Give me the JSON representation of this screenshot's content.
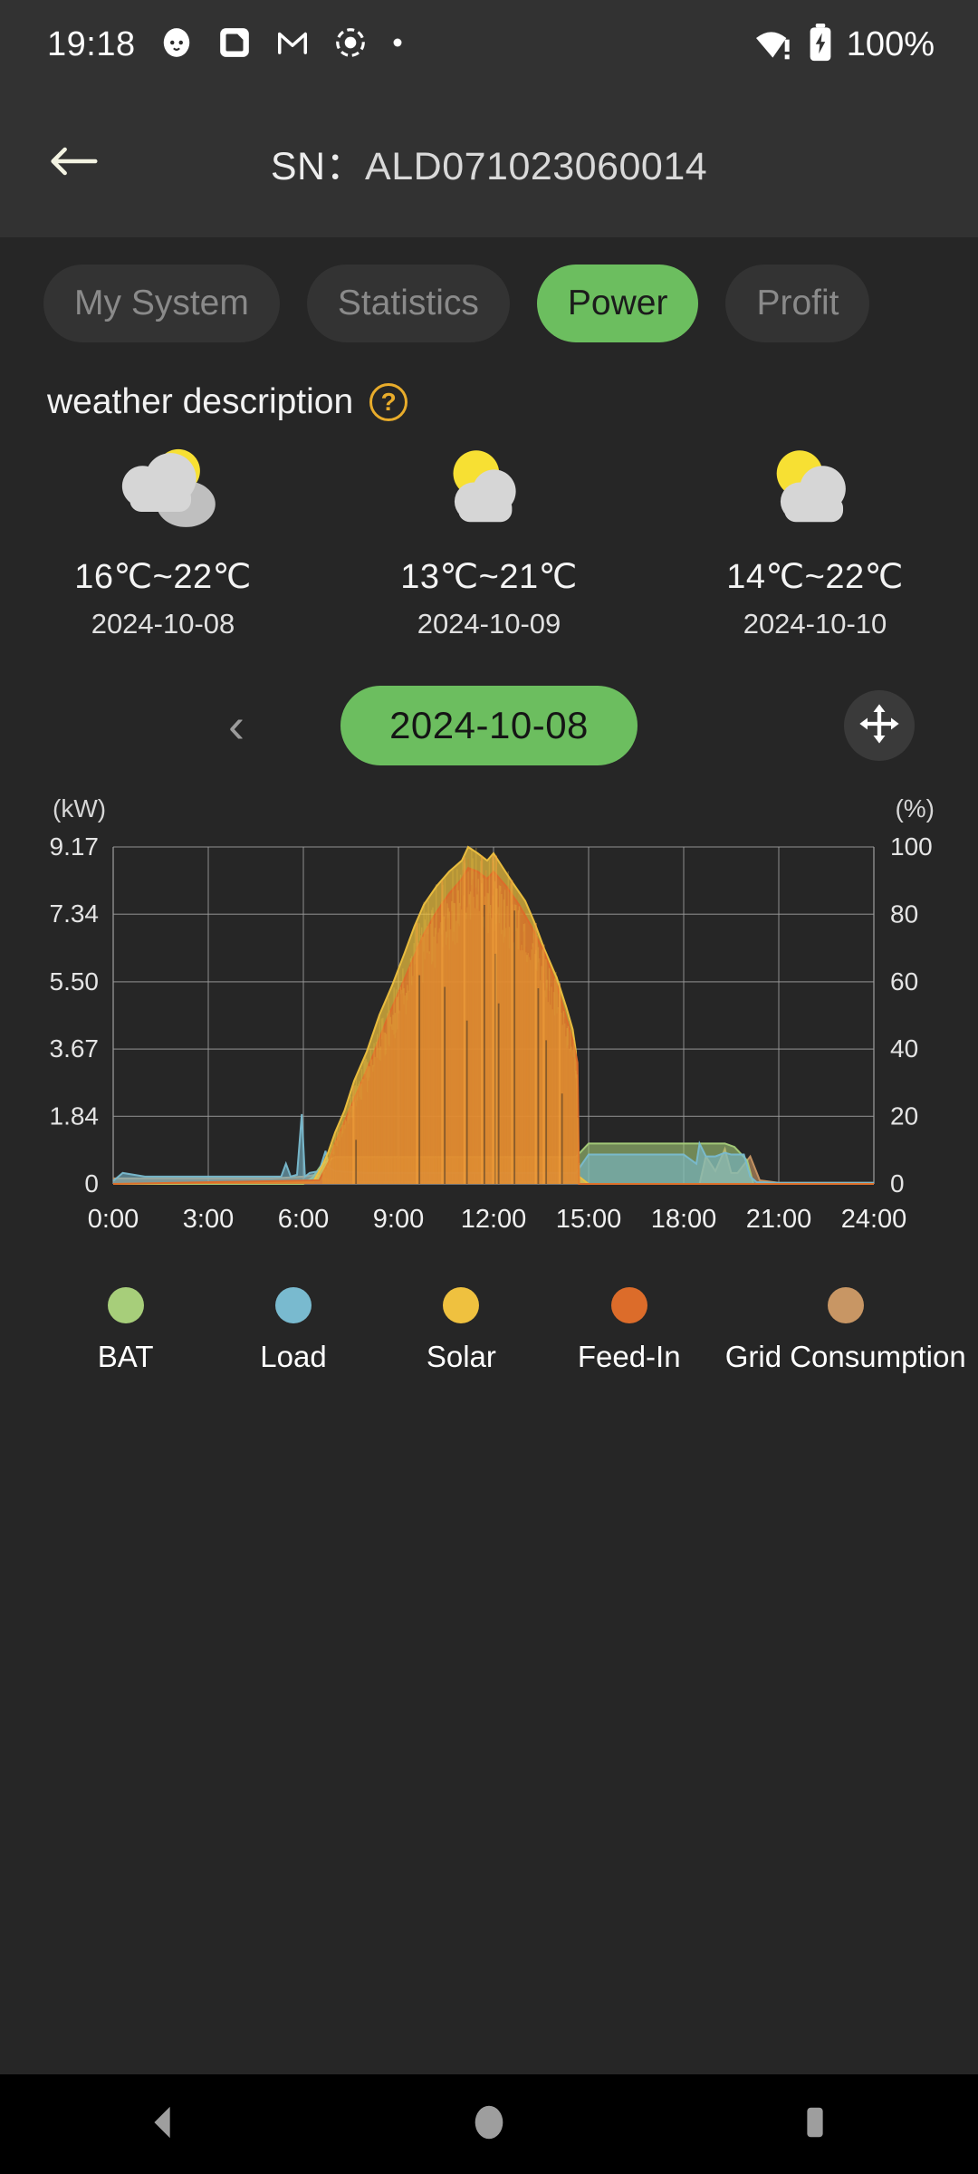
{
  "status_bar": {
    "time": "19:18",
    "battery_percent": "100%",
    "icons": [
      "cat-face-icon",
      "note-app-icon",
      "gmail-icon",
      "camera-record-icon",
      "dot-icon"
    ],
    "wifi_icon": "wifi-warning-icon",
    "battery_icon": "battery-charging-icon"
  },
  "app_bar": {
    "back_icon": "back-arrow-icon",
    "sn_key": "SN：",
    "sn_value": "ALD071023060014"
  },
  "tabs": [
    {
      "label": "My System",
      "active": false
    },
    {
      "label": "Statistics",
      "active": false
    },
    {
      "label": "Power",
      "active": true
    },
    {
      "label": "Profit",
      "active": false
    }
  ],
  "weather": {
    "title": "weather description",
    "help_icon": "question-mark-icon",
    "forecast": [
      {
        "icon": "partly-cloudy-icon",
        "temp": "16℃~22℃",
        "date": "2024-10-08"
      },
      {
        "icon": "partly-cloudy-icon",
        "temp": "13℃~21℃",
        "date": "2024-10-09"
      },
      {
        "icon": "partly-cloudy-icon",
        "temp": "14℃~22℃",
        "date": "2024-10-10"
      }
    ]
  },
  "date_selector": {
    "prev_icon": "chevron-left-icon",
    "current_date": "2024-10-08",
    "fullscreen_icon": "move-expand-icon"
  },
  "colors": {
    "accent_green": "#6cbe5f",
    "bat": "#a7ce7a",
    "load": "#79bacf",
    "solar": "#efc13f",
    "feed_in": "#dc6c2a",
    "grid": "#c89664",
    "background": "#262626",
    "grid_line": "#9a9a9a"
  },
  "chart_data": {
    "type": "area",
    "title": "",
    "xlabel": "",
    "ylabel": "(kW)",
    "y2label": "(%)",
    "grid": true,
    "legend_position": "bottom",
    "ylim": [
      0,
      9.17
    ],
    "y2lim": [
      0,
      100
    ],
    "ytick_labels": [
      "0",
      "1.84",
      "3.67",
      "5.50",
      "7.34",
      "9.17"
    ],
    "ytick_values": [
      0,
      1.84,
      3.67,
      5.5,
      7.34,
      9.17
    ],
    "y2tick_labels": [
      "0",
      "20",
      "40",
      "60",
      "80",
      "100"
    ],
    "y2tick_values": [
      0,
      20,
      40,
      60,
      80,
      100
    ],
    "xtick_labels": [
      "0:00",
      "3:00",
      "6:00",
      "9:00",
      "12:00",
      "15:00",
      "18:00",
      "21:00",
      "24:00"
    ],
    "xlim": [
      0,
      24
    ],
    "series": [
      {
        "name": "BAT",
        "color": "#a7ce7a",
        "axis": "right",
        "x": [
          0,
          5.0,
          5.5,
          6.0,
          6.3,
          6.6,
          7.0,
          8.0,
          9.0,
          10.0,
          11.0,
          12.0,
          13.0,
          14.0,
          14.6,
          15.0,
          16.0,
          17.0,
          18.0,
          18.6,
          19.0,
          19.3,
          19.6,
          20.0,
          20.2,
          21.0,
          24.0
        ],
        "values": [
          0,
          0,
          0,
          0,
          2,
          6,
          8,
          8,
          8,
          8,
          8,
          8,
          8,
          8,
          8,
          12,
          12,
          12,
          12,
          12,
          12,
          12,
          11,
          7,
          0,
          0,
          0
        ]
      },
      {
        "name": "Load",
        "color": "#79bacf",
        "axis": "left",
        "x": [
          0,
          0.3,
          1.0,
          2.0,
          3.0,
          4.0,
          5.0,
          5.3,
          5.45,
          5.6,
          5.8,
          5.95,
          6.05,
          6.2,
          6.5,
          6.7,
          6.8,
          7.0,
          8.0,
          9.0,
          11.0,
          12.0,
          13.0,
          14.0,
          14.6,
          15.0,
          16.0,
          17.0,
          18.0,
          18.4,
          18.5,
          18.7,
          19.0,
          19.3,
          19.5,
          19.6,
          19.9,
          20.1,
          20.3,
          21.0,
          24.0
        ],
        "values": [
          0.08,
          0.3,
          0.2,
          0.2,
          0.2,
          0.2,
          0.2,
          0.2,
          0.55,
          0.2,
          0.25,
          1.9,
          0.2,
          0.3,
          0.35,
          0.9,
          0.45,
          0.35,
          0.3,
          0.3,
          0.3,
          0.3,
          0.3,
          0.3,
          0.3,
          0.8,
          0.8,
          0.8,
          0.8,
          0.55,
          1.1,
          0.75,
          0.75,
          0.85,
          0.8,
          0.8,
          0.8,
          0.2,
          0.05,
          0.03,
          0.03
        ]
      },
      {
        "name": "Solar",
        "color": "#efc13f",
        "axis": "left",
        "x": [
          0,
          6.3,
          6.6,
          6.8,
          7.0,
          7.3,
          7.6,
          8.0,
          8.4,
          8.8,
          9.2,
          9.5,
          9.8,
          10.2,
          10.6,
          11.0,
          11.2,
          11.5,
          11.8,
          12.0,
          12.3,
          12.6,
          13.0,
          13.3,
          13.6,
          14.0,
          14.3,
          14.5,
          14.6,
          14.7,
          15.0,
          24.0
        ],
        "values": [
          0,
          0.05,
          0.5,
          0.9,
          1.4,
          2.0,
          2.8,
          3.6,
          4.6,
          5.4,
          6.3,
          7.0,
          7.6,
          8.1,
          8.5,
          8.8,
          9.17,
          9.0,
          8.8,
          9.0,
          8.6,
          8.2,
          7.7,
          7.1,
          6.4,
          5.6,
          4.8,
          4.2,
          3.6,
          0.2,
          0,
          0
        ]
      },
      {
        "name": "Feed-In",
        "color": "#dc6c2a",
        "axis": "left",
        "x": [
          0,
          6.5,
          6.8,
          7.0,
          7.4,
          7.8,
          8.2,
          8.6,
          9.0,
          9.4,
          9.8,
          10.2,
          10.6,
          11.0,
          11.2,
          11.5,
          11.8,
          12.0,
          12.4,
          12.8,
          13.2,
          13.6,
          14.0,
          14.3,
          14.5,
          14.65,
          14.7,
          24.0
        ],
        "values": [
          0,
          0.1,
          0.6,
          1.1,
          1.9,
          2.7,
          3.5,
          4.4,
          5.2,
          6.0,
          6.8,
          7.4,
          7.9,
          8.3,
          8.6,
          8.5,
          8.3,
          8.5,
          8.1,
          7.6,
          7.0,
          6.3,
          5.4,
          4.5,
          3.9,
          3.3,
          0,
          0
        ]
      },
      {
        "name": "Grid Consumption",
        "color": "#c89664",
        "axis": "left",
        "x": [
          0,
          1.0,
          2.0,
          3.0,
          4.0,
          5.0,
          5.6,
          6.0,
          6.4,
          6.8,
          7.2,
          8.0,
          9.0,
          10.0,
          11.0,
          12.0,
          13.0,
          14.0,
          14.6,
          14.7,
          18.5,
          18.7,
          19.0,
          19.3,
          19.5,
          19.7,
          20.1,
          20.4,
          21.0,
          24.0
        ],
        "values": [
          0.15,
          0.15,
          0.15,
          0.15,
          0.15,
          0.15,
          0.18,
          0.2,
          0.25,
          0.1,
          0.05,
          0.05,
          0.05,
          0.05,
          0.05,
          0.05,
          0.05,
          0.05,
          0.05,
          0,
          0,
          0.75,
          0.35,
          0.95,
          0.3,
          0.3,
          0.75,
          0.1,
          0.03,
          0.03
        ]
      }
    ]
  },
  "legend": [
    {
      "label": "BAT",
      "color": "#a7ce7a"
    },
    {
      "label": "Load",
      "color": "#79bacf"
    },
    {
      "label": "Solar",
      "color": "#efc13f"
    },
    {
      "label": "Feed-In",
      "color": "#dc6c2a"
    },
    {
      "label": "Grid Consumption",
      "color": "#c89664"
    }
  ],
  "nav_bar": {
    "back": "nav-back-icon",
    "home": "nav-home-icon",
    "recents": "nav-recents-icon"
  }
}
